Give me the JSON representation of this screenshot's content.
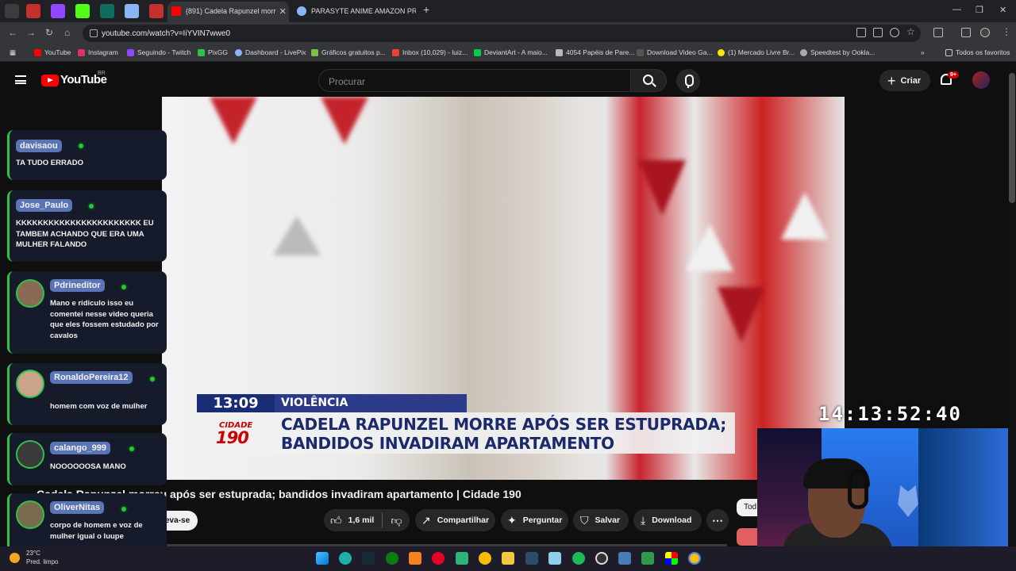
{
  "browser": {
    "tabs": [
      {
        "label": "(891) Cadela Rapunzel morr",
        "active": true
      },
      {
        "label": "PARASYTE ANIME AMAZON PR",
        "active": false
      }
    ],
    "url": "youtube.com/watch?v=IiYVIN7wwe0",
    "bookmarks": [
      "YouTube",
      "Instagram",
      "Seguindo - Twitch",
      "PixGG",
      "Dashboard - LivePix",
      "Gráficos gratuitos p...",
      "Inbox (10,029) - luiz...",
      "DeviantArt - A maio...",
      "4054 Papéis de Pare...",
      "Download Video Ga...",
      "(1) Mercado Livre Br...",
      "Speedtest by Ookla..."
    ],
    "bookmarks_folder": "Todos os favoritos"
  },
  "youtube": {
    "logo_text": "YouTube",
    "region": "BR",
    "search_placeholder": "Procurar",
    "create_label": "Criar",
    "notif_badge": "9+"
  },
  "video": {
    "lower_third": {
      "time": "13:09",
      "category": "VIOLÊNCIA",
      "headline_line1": "CADELA RAPUNZEL MORRE APÓS SER ESTUPRADA;",
      "headline_line2": "BANDIDOS INVADIRAM APARTAMENTO",
      "logo_top": "CIDADE",
      "logo_num": "190"
    },
    "overlay_clock": "14:13:52:40",
    "title": "Cadela Rapunzel morreu após ser estuprada; bandidos invadiram apartamento | Cidade 190",
    "subscribe_label": "eva-se",
    "likes": "1,6 mil",
    "share_label": "Compartilhar",
    "ask_label": "Perguntar",
    "save_label": "Salvar",
    "download_label": "Download",
    "filter_chip": "Tod"
  },
  "chat": [
    {
      "user": "davisaou",
      "text": "TA TUDO ERRADO",
      "avatar": false
    },
    {
      "user": "Jose_Paulo",
      "text": "KKKKKKKKKKKKKKKKKKKKKKK EU TAMBEM ACHANDO QUE ERA UMA MULHER FALANDO",
      "avatar": false
    },
    {
      "user": "Pdrineditor",
      "text": "Mano e ridiculo isso eu comentei nesse video queria que eles fossem estudado por cavalos",
      "avatar": true
    },
    {
      "user": "RonaldoPereira12",
      "text": "homem com voz de mulher",
      "avatar": true
    },
    {
      "user": "calango_999",
      "text": "NOOOOOOSA MANO",
      "avatar": true
    },
    {
      "user": "OliverNitas",
      "text": "corpo de homem e voz de mulher igual o luupe",
      "avatar": true
    }
  ],
  "taskbar": {
    "weather_temp": "23°C",
    "weather_text": "Pred. limpo"
  },
  "colors": {
    "yt_red": "#ff0000",
    "chat_border": "#2ec24a",
    "username_bg": "#5a74b5",
    "news_blue": "#1a2c73"
  }
}
